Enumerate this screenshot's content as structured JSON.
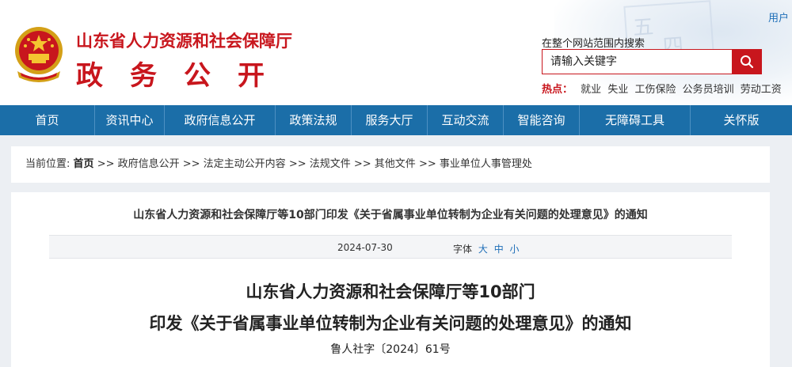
{
  "header": {
    "site_title": "山东省人力资源和社会保障厅",
    "site_subtitle": "政务公开",
    "user_link": "用户",
    "search_label": "在整个网站范围内搜索",
    "search_placeholder": "请输入关键字",
    "hot_label": "热点：",
    "hot_links": [
      "就业",
      "失业",
      "工伤保险",
      "公务员培训",
      "劳动工资"
    ]
  },
  "nav": {
    "items": [
      "首页",
      "资讯中心",
      "政府信息公开",
      "政策法规",
      "服务大厅",
      "互动交流",
      "智能咨询",
      "无障碍工具",
      "关怀版"
    ]
  },
  "breadcrumb": {
    "prefix": "当前位置:",
    "items": [
      "首页",
      ">> 政府信息公开",
      ">> 法定主动公开内容",
      ">> 法规文件",
      ">> 其他文件",
      ">> 事业单位人事管理处"
    ]
  },
  "article": {
    "head_title": "山东省人力资源和社会保障厅等10部门印发《关于省属事业单位转制为企业有关问题的处理意见》的通知",
    "date": "2024-07-30",
    "font_label": "字体",
    "font_sizes": [
      "大",
      "中",
      "小"
    ],
    "title_line1": "山东省人力资源和社会保障厅等10部门",
    "title_line2": "印发《关于省属事业单位转制为企业有关问题的处理意见》的通知",
    "doc_number": "鲁人社字〔2024〕61号"
  },
  "colors": {
    "brand_red": "#c8161d",
    "nav_blue": "#1b6ea8",
    "link_blue": "#1f6fb8"
  }
}
